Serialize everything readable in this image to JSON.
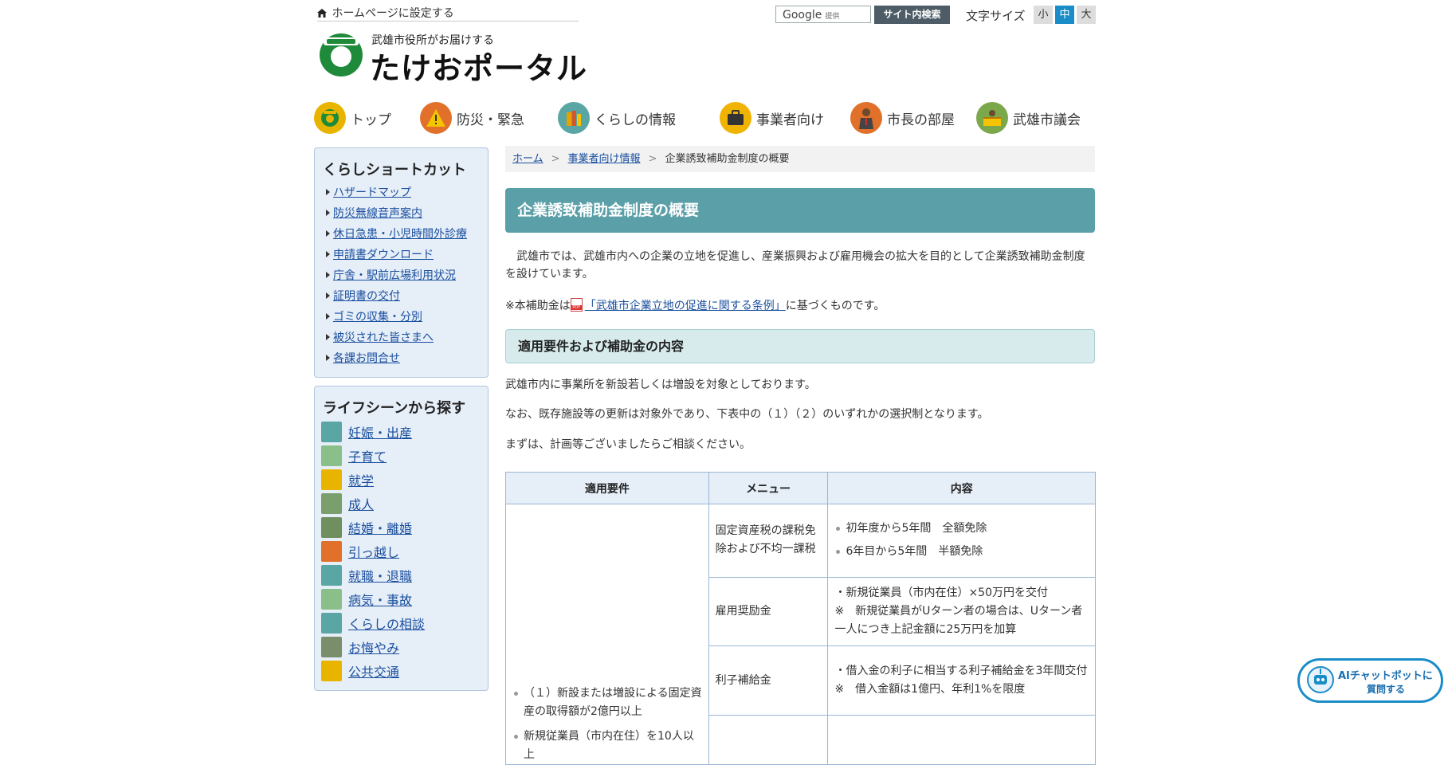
{
  "header": {
    "set_homepage": "ホームページに設定する",
    "logo_tagline": "武雄市役所がお届けする",
    "logo_name": "たけおポータル",
    "search_placeholder": "Google",
    "search_provided": "提供",
    "search_button": "サイト内検索",
    "font_size_label": "文字サイズ",
    "font_sizes": [
      "小",
      "中",
      "大"
    ],
    "font_size_selected": "中"
  },
  "global_nav": [
    {
      "label": "トップ",
      "icon": "city-emblem-icon",
      "color": "#e8b400"
    },
    {
      "label": "防災・緊急",
      "icon": "warning-icon",
      "color": "#e0702a"
    },
    {
      "label": "くらしの情報",
      "icon": "books-icon",
      "color": "#5aa6a4"
    },
    {
      "label": "事業者向け",
      "icon": "briefcase-icon",
      "color": "#f0b400"
    },
    {
      "label": "市長の部屋",
      "icon": "mayor-icon",
      "color": "#e0702a"
    },
    {
      "label": "武雄市議会",
      "icon": "assembly-icon",
      "color": "#7aa84a"
    }
  ],
  "sidebar": {
    "shortcut_title": "くらしショートカット",
    "shortcuts": [
      "ハザードマップ",
      "防災無線音声案内",
      "休日急患・小児時間外診療",
      "申請書ダウンロード",
      "庁舎・駅前広場利用状況",
      "証明書の交付",
      "ゴミの収集・分別",
      "被災された皆さまへ",
      "各課お問合せ"
    ],
    "lifescene_title": "ライフシーンから探す",
    "lifescenes": [
      {
        "label": "妊娠・出産",
        "icon": "pregnancy-icon"
      },
      {
        "label": "子育て",
        "icon": "baby-bottle-icon"
      },
      {
        "label": "就学",
        "icon": "school-icon"
      },
      {
        "label": "成人",
        "icon": "adult-icon"
      },
      {
        "label": "結婚・離婚",
        "icon": "couple-icon"
      },
      {
        "label": "引っ越し",
        "icon": "moving-truck-icon"
      },
      {
        "label": "就職・退職",
        "icon": "briefcase-icon"
      },
      {
        "label": "病気・事故",
        "icon": "medicine-icon"
      },
      {
        "label": "くらしの相談",
        "icon": "consultation-icon"
      },
      {
        "label": "お悔やみ",
        "icon": "condolence-icon"
      },
      {
        "label": "公共交通",
        "icon": "train-icon"
      }
    ]
  },
  "breadcrumb": {
    "home": "ホーム",
    "parent": "事業者向け情報",
    "current": "企業誘致補助金制度の概要"
  },
  "main": {
    "title": "企業誘致補助金制度の概要",
    "intro": "　武雄市では、武雄市内への企業の立地を促進し、産業振興および雇用機会の拡大を目的として企業誘致補助金制度を設けています。",
    "basis_prefix": "※本補助金は",
    "basis_link": "「武雄市企業立地の促進に関する条例」",
    "basis_suffix": "に基づくものです。",
    "section_title": "適用要件および補助金の内容",
    "p1": "武雄市内に事業所を新設若しくは増設を対象としております。",
    "p2": "なお、既存施設等の更新は対象外であり、下表中の（１）（２）のいずれかの選択制となります。",
    "p3": "まずは、計画等ございましたらご相談ください。",
    "table": {
      "headers": [
        "適用要件",
        "メニュー",
        "内容"
      ],
      "requirement_items": [
        "（１）新設または増設による固定資産の取得額が2億円以上",
        "新規従業員（市内在住）を10人以上"
      ],
      "rows": [
        {
          "menu": "固定資産税の課税免除および不均一課税",
          "content_items": [
            "初年度から5年間　全額免除",
            "6年目から5年間　半額免除"
          ]
        },
        {
          "menu": "雇用奨励金",
          "content_lines": [
            "・新規従業員（市内在住）×50万円を交付",
            "※　新規従業員がUターン者の場合は、Uターン者一人につき上記金額に25万円を加算"
          ]
        },
        {
          "menu": "利子補給金",
          "content_lines": [
            "・借入金の利子に相当する利子補給金を3年間交付",
            "※　借入金額は1億円、年利1%を限度"
          ]
        }
      ]
    }
  },
  "chatbot": {
    "line1": "AIチャットボットに",
    "line2": "質問する"
  }
}
